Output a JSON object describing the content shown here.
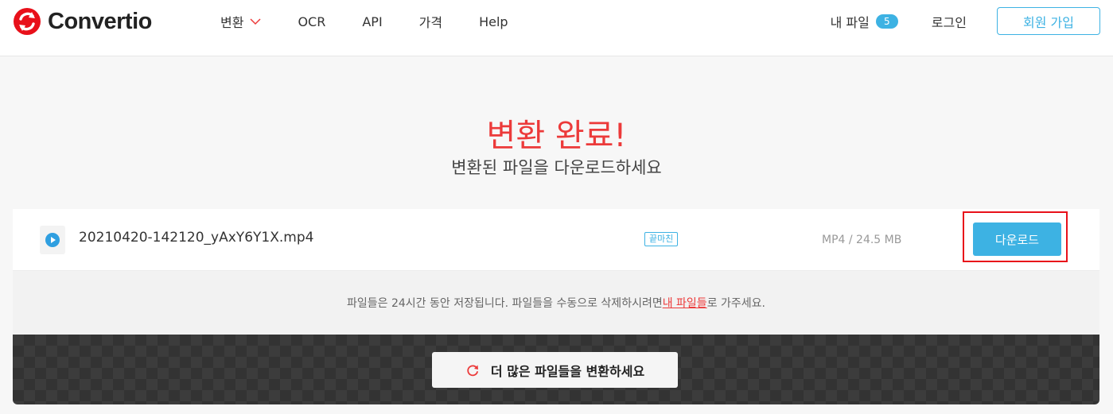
{
  "header": {
    "logo_text": "Convertio",
    "nav": [
      {
        "label": "변환"
      },
      {
        "label": "OCR"
      },
      {
        "label": "API"
      },
      {
        "label": "가격"
      },
      {
        "label": "Help"
      }
    ],
    "my_files_label": "내 파일",
    "my_files_count": "5",
    "login_label": "로그인",
    "signup_label": "회원 가입"
  },
  "hero": {
    "title": "변환 완료!",
    "subtitle": "변환된 파일을 다운로드하세요"
  },
  "file": {
    "name": "20210420-142120_yAxY6Y1X.mp4",
    "status": "끝마친",
    "meta": "MP4 / 24.5 MB",
    "download_label": "다운로드",
    "icon": "play-icon"
  },
  "info": {
    "text_before": "파일들은 24시간 동안 저장됩니다. 파일들을 수동으로 삭제하시려면 ",
    "link_text": "내 파일들",
    "text_after": "로 가주세요."
  },
  "more": {
    "label": "더 많은 파일들을 변환하세요",
    "icon": "refresh-icon"
  },
  "colors": {
    "accent": "#3db2e3",
    "brand_red": "#ec3a3a",
    "highlight": "#e8101a"
  }
}
